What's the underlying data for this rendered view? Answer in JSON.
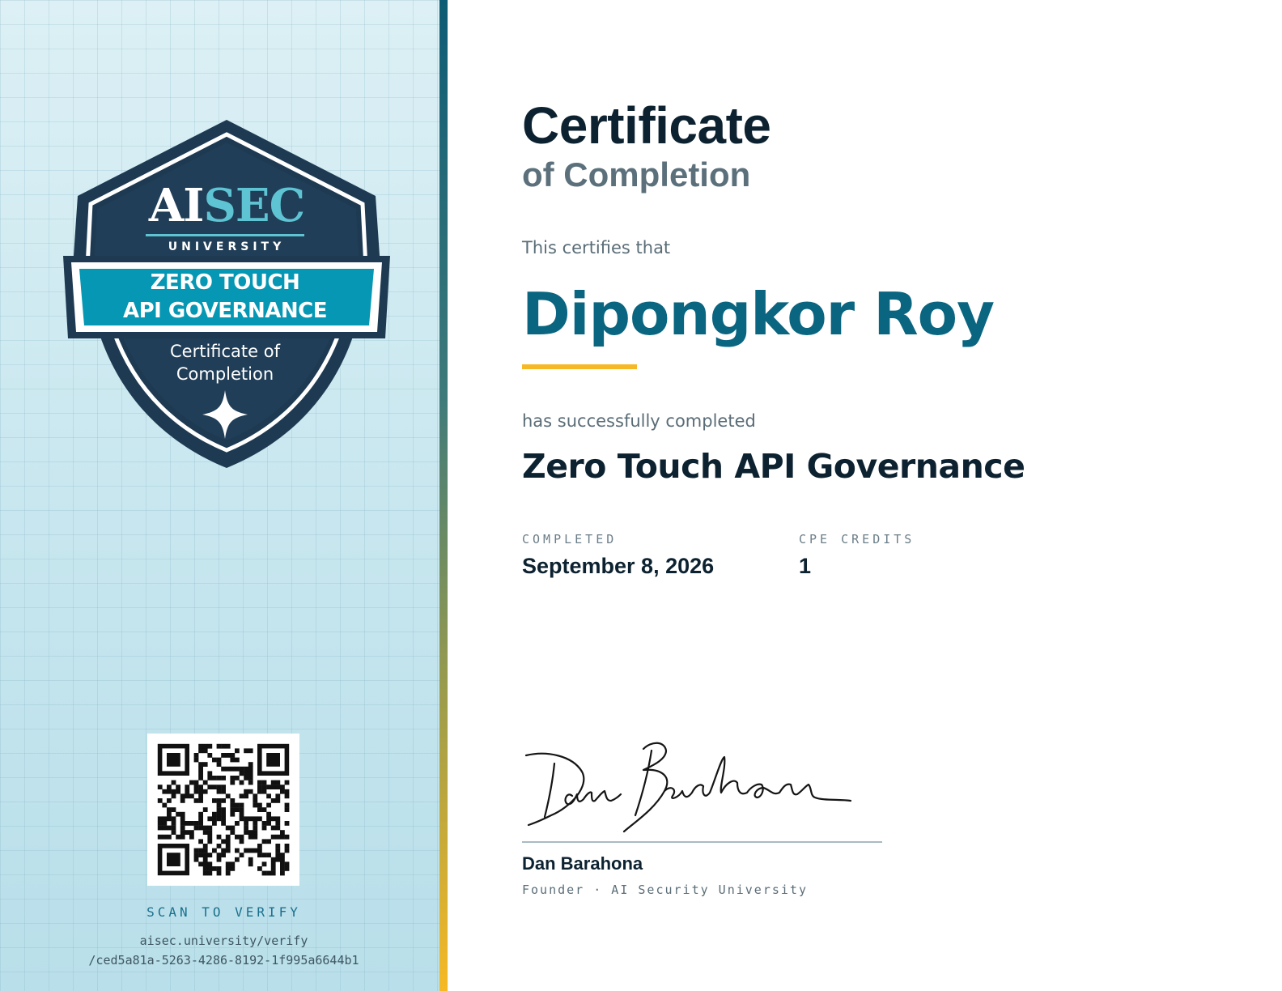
{
  "badge": {
    "logo_part1": "AI",
    "logo_part2": "SEC",
    "logo_sub": "UNIVERSITY",
    "banner_line1": "ZERO TOUCH",
    "banner_line2": "API GOVERNANCE",
    "sub_line1": "Certificate of",
    "sub_line2": "Completion"
  },
  "verify": {
    "label": "SCAN TO VERIFY",
    "url_line1": "aisec.university/verify",
    "url_line2": "/ced5a81a-5263-4286-8192-1f995a6644b1"
  },
  "certificate": {
    "title": "Certificate",
    "subtitle": "of Completion",
    "certifies_text": "This certifies that",
    "recipient_name": "Dipongkor Roy",
    "completed_text": "has successfully completed",
    "course_name": "Zero Touch API Governance"
  },
  "details": {
    "completed_label": "COMPLETED",
    "completed_value": "September 8, 2026",
    "credits_label": "CPE CREDITS",
    "credits_value": "1"
  },
  "signer": {
    "name": "Dan Barahona",
    "title": "Founder · AI Security University"
  },
  "colors": {
    "navy": "#1d3a52",
    "teal_banner": "#0597b3",
    "accent_teal": "#5ec3d2",
    "recipient_blue": "#0a6580",
    "gold": "#f6b925"
  }
}
